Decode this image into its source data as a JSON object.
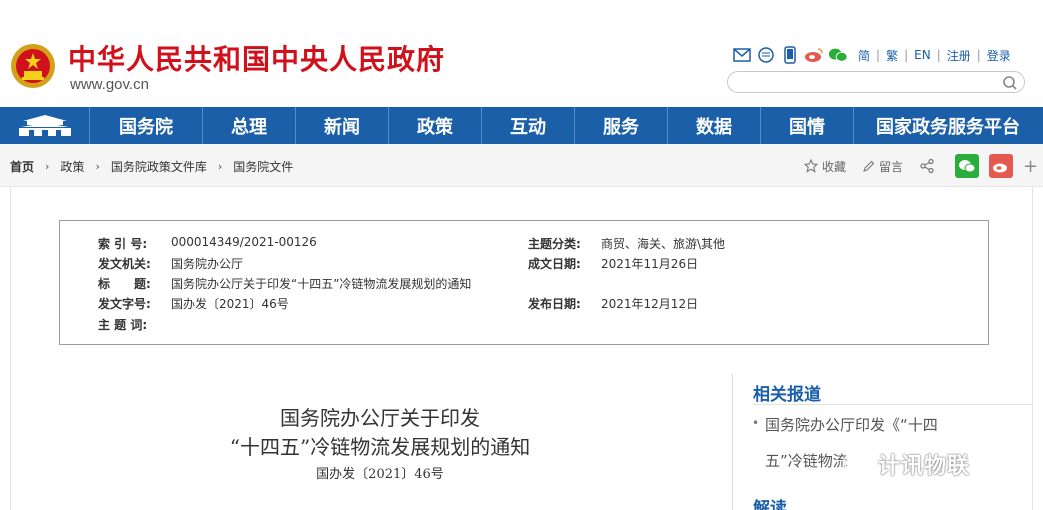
{
  "header": {
    "site_title": "中华人民共和国中央人民政府",
    "site_url": "www.gov.cn",
    "lang_links": [
      "简",
      "繁",
      "EN",
      "注册",
      "登录"
    ],
    "search": {
      "placeholder": ""
    }
  },
  "nav": {
    "items": [
      "国务院",
      "总理",
      "新闻",
      "政策",
      "互动",
      "服务",
      "数据",
      "国情",
      "国家政务服务平台"
    ]
  },
  "breadcrumb": {
    "items": [
      "首页",
      "政策",
      "国务院政策文件库",
      "国务院文件"
    ],
    "actions": {
      "favorite": "收藏",
      "comment": "留言"
    }
  },
  "info": {
    "index_no_label": "索 引 号:",
    "index_no": "000014349/2021-00126",
    "issuer_label": "发文机关:",
    "issuer": "国务院办公厅",
    "title_label": "标　　题:",
    "title": "国务院办公厅关于印发“十四五”冷链物流发展规划的通知",
    "doc_no_label": "发文字号:",
    "doc_no": "国办发〔2021〕46号",
    "keywords_label": "主 题 词:",
    "keywords": "",
    "category_label": "主题分类:",
    "category": "商贸、海关、旅游\\其他",
    "written_label": "成文日期:",
    "written": "2021年11月26日",
    "published_label": "发布日期:",
    "published": "2021年12月12日"
  },
  "article": {
    "title_line1": "国务院办公厅关于印发",
    "title_line2": "“十四五”冷链物流发展规划的通知",
    "doc_no": "国办发〔2021〕46号"
  },
  "sidebar": {
    "related_heading": "相关报道",
    "related_item_line1": "国务院办公厅印发《“十四",
    "related_item_line2": "五”冷链物流",
    "interpretation_heading": "解读"
  },
  "watermark": {
    "text": "计讯物联"
  },
  "colors": {
    "brand_red": "#d0111b",
    "nav_blue": "#1a5fa8",
    "wechat_green": "#2bad3c",
    "weibo_red": "#e6594f"
  }
}
